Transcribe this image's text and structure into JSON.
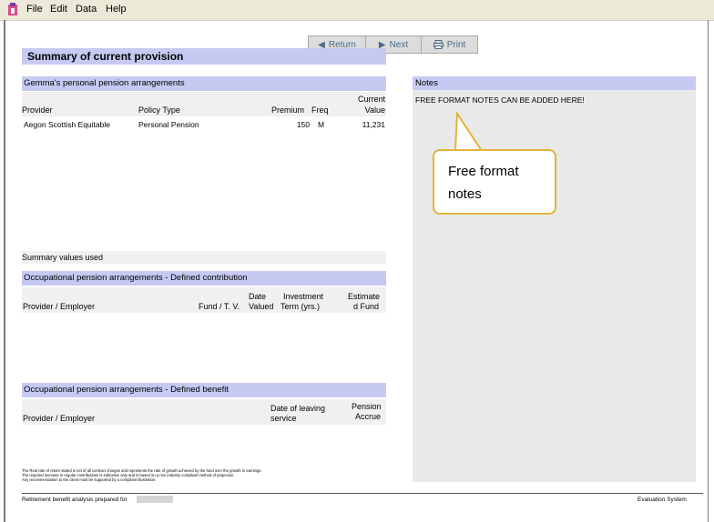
{
  "menu": [
    "File",
    "Edit",
    "Data",
    "Help"
  ],
  "toolbar": {
    "return_label": "Return",
    "next_label": "Next",
    "print_label": "Print"
  },
  "page": {
    "title": "Summary of current provision"
  },
  "personal": {
    "header": "Gemma's personal pension arrangements",
    "columns": {
      "provider": "Provider",
      "policy_type": "Policy Type",
      "premium": "Premium",
      "freq": "Freq",
      "current_value_line1": "Current",
      "current_value_line2": "Value"
    },
    "rows": [
      {
        "provider": "Aegon Scottish Equitable",
        "policy_type": "Personal Pension",
        "premium": "150",
        "freq": "M",
        "value": "11,231"
      }
    ]
  },
  "summary_values": "Summary values used",
  "dc": {
    "header": "Occupational pension arrangements - Defined contribution",
    "columns": {
      "provider": "Provider / Employer",
      "fund_line2": "Fund / T. V.",
      "date_line1": "Date",
      "date_line2": "Valued",
      "term_line1": "Investment",
      "term_line2": "Term (yrs.)",
      "est_line1": "Estimate",
      "est_line2": "d Fund"
    }
  },
  "db": {
    "header": "Occupational pension arrangements - Defined benefit",
    "columns": {
      "provider": "Provider / Employer",
      "leaving_line1": "Date of leaving",
      "leaving_line2": "service",
      "pension_line1": "Pension",
      "pension_line2": "Accrue"
    }
  },
  "notes": {
    "header": "Notes",
    "text": "FREE FORMAT NOTES CAN BE ADDED HERE!",
    "callout": "Free format notes"
  },
  "footnote": [
    "The Real rate of return stated is net of all contract charges and represents the rate of growth achieved by the fund over the growth in earnings.",
    "The required increase in regular contributions is indicative only and is based on a non industry compliant method of projection.",
    "Any recommendation to the client must be supported by a compliant illustration."
  ],
  "footer": {
    "left": "Retirement benefit analysis prepared for",
    "right": "Evaluation System"
  }
}
